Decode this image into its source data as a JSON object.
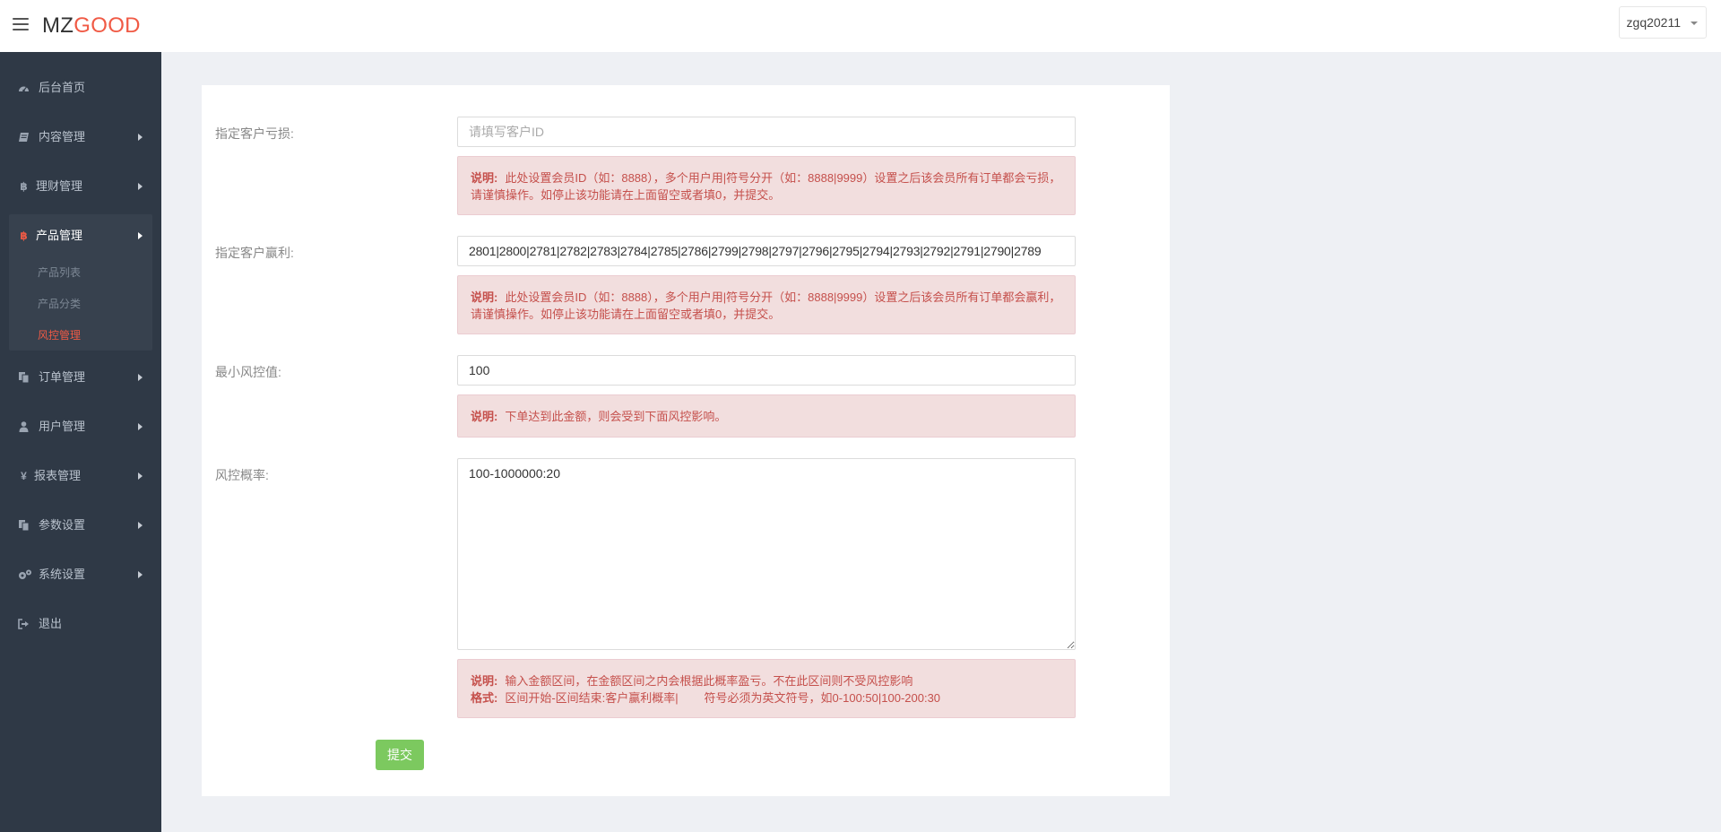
{
  "header": {
    "brand_part1": "MZ",
    "brand_part2": "GOOD",
    "username": "zgq20211"
  },
  "sidebar": {
    "items": [
      {
        "label": "后台首页",
        "icon": "dashboard-icon"
      },
      {
        "label": "内容管理",
        "icon": "book-icon"
      },
      {
        "label": "理财管理",
        "icon": "bitcoin-icon"
      },
      {
        "label": "产品管理",
        "icon": "bitcoin-icon"
      },
      {
        "label": "订单管理",
        "icon": "copy-icon"
      },
      {
        "label": "用户管理",
        "icon": "user-icon"
      },
      {
        "label": "报表管理",
        "icon": "yen-icon"
      },
      {
        "label": "参数设置",
        "icon": "copy-icon"
      },
      {
        "label": "系统设置",
        "icon": "gears-icon"
      },
      {
        "label": "退出",
        "icon": "sign-out-icon"
      }
    ],
    "sub_items": [
      {
        "label": "产品列表"
      },
      {
        "label": "产品分类"
      },
      {
        "label": "风控管理"
      }
    ],
    "accent_color": "#f05a45"
  },
  "form": {
    "loss_customer": {
      "label": "指定客户亏损:",
      "placeholder": "请填写客户ID",
      "value": "",
      "note_label": "说明:",
      "note_text": "此处设置会员ID（如：8888），多个用户用|符号分开（如：8888|9999）设置之后该会员所有订单都会亏损，请谨慎操作。如停止该功能请在上面留空或者填0，并提交。"
    },
    "win_customer": {
      "label": "指定客户赢利:",
      "value": "2801|2800|2781|2782|2783|2784|2785|2786|2799|2798|2797|2796|2795|2794|2793|2792|2791|2790|2789",
      "note_label": "说明:",
      "note_text": "此处设置会员ID（如：8888），多个用户用|符号分开（如：8888|9999）设置之后该会员所有订单都会赢利，请谨慎操作。如停止该功能请在上面留空或者填0，并提交。"
    },
    "min_risk": {
      "label": "最小风控值:",
      "value": "100",
      "note_label": "说明:",
      "note_text": "下单达到此金额，则会受到下面风控影响。"
    },
    "risk_rate": {
      "label": "风控概率:",
      "value": "100-1000000:20",
      "note_label": "说明:",
      "note_text": "输入金额区间，在金额区间之内会根据此概率盈亏。不在此区间则不受风控影响",
      "format_label": "格式:",
      "format_text": "区间开始-区间结束:客户赢利概率|        符号必须为英文符号，如0-100:50|100-200:30"
    },
    "submit_label": "提交"
  }
}
